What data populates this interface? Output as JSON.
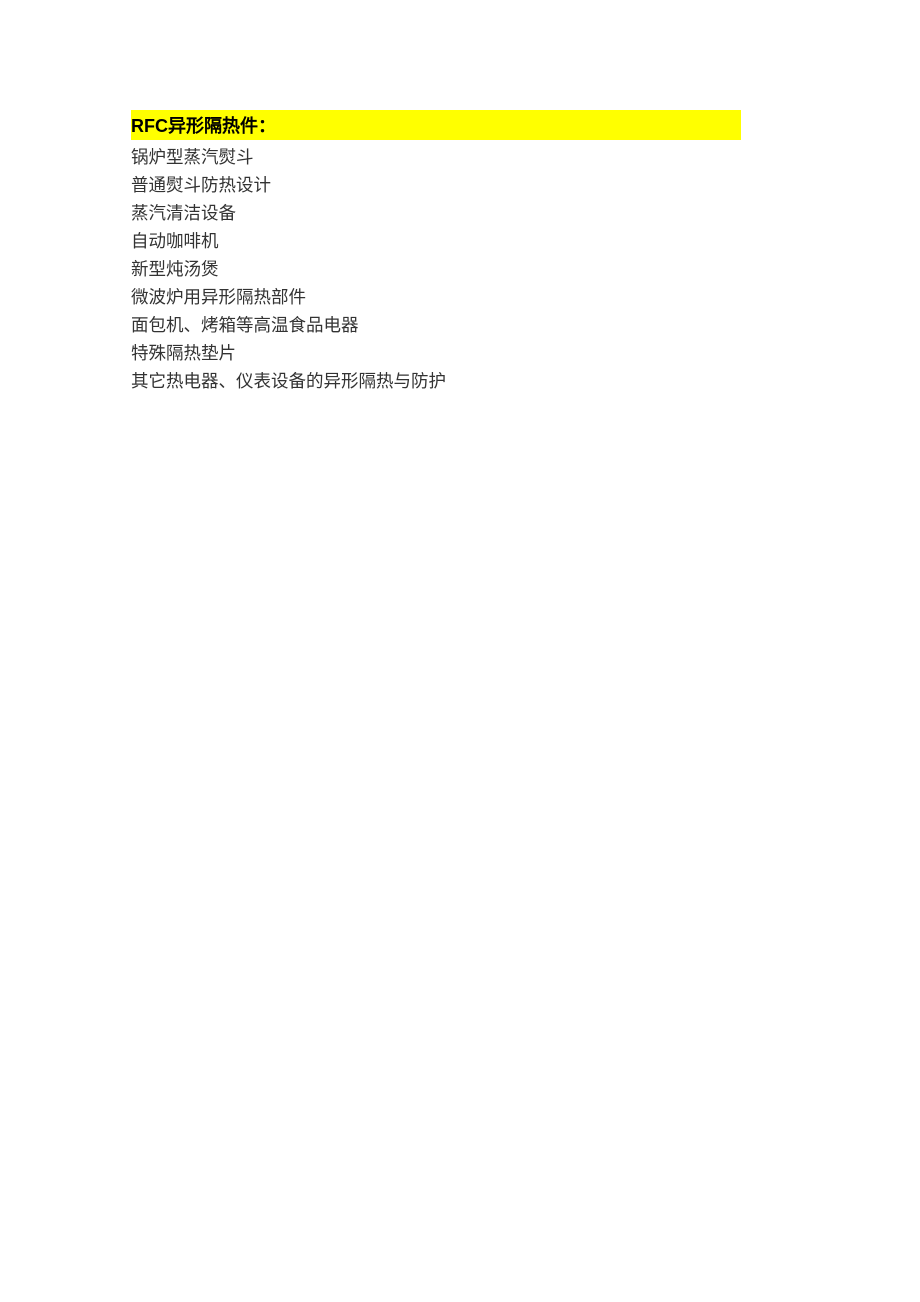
{
  "heading": "RFC异形隔热件：",
  "items": [
    "锅炉型蒸汽熨斗",
    "普通熨斗防热设计",
    "蒸汽清洁设备",
    "自动咖啡机",
    "新型炖汤煲",
    "微波炉用异形隔热部件",
    "面包机、烤箱等高温食品电器",
    "特殊隔热垫片",
    "其它热电器、仪表设备的异形隔热与防护"
  ]
}
